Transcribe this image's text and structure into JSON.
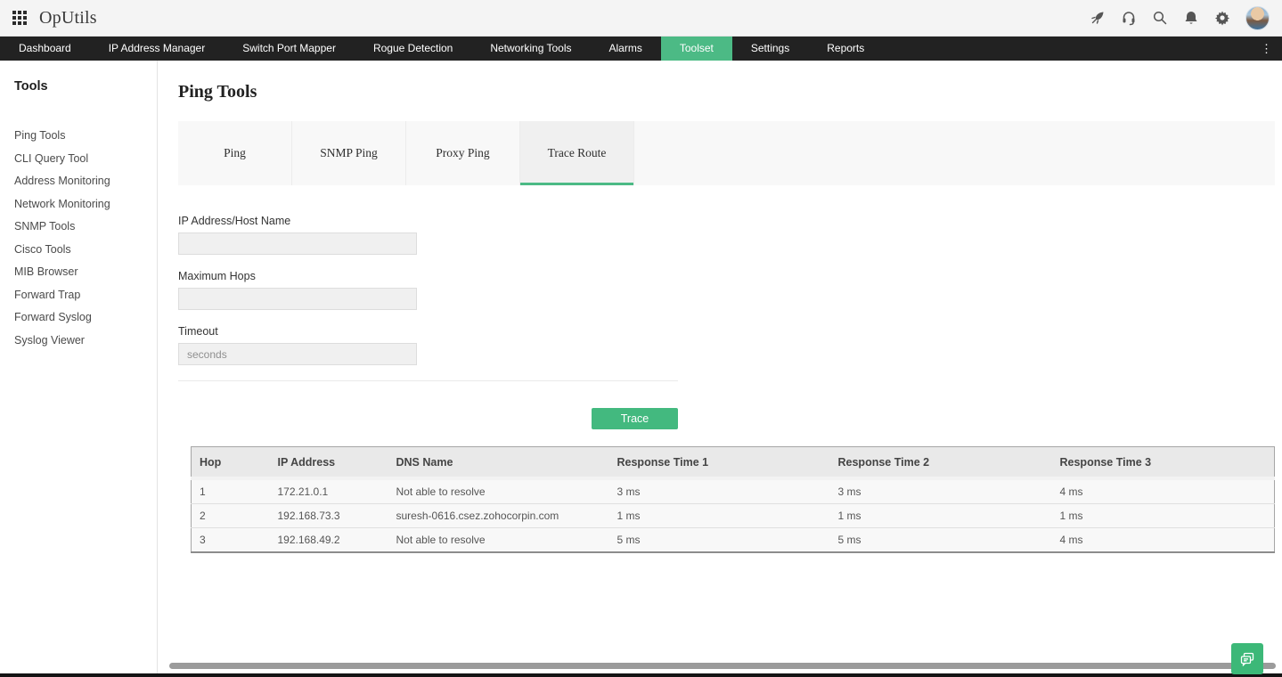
{
  "app": {
    "logo": "OpUtils"
  },
  "topbar": {
    "icons": [
      "launcher-grid-icon",
      "rocket-icon",
      "headset-icon",
      "search-icon",
      "bell-icon",
      "gear-icon",
      "avatar"
    ]
  },
  "topnav": {
    "items": [
      "Dashboard",
      "IP Address Manager",
      "Switch Port Mapper",
      "Rogue Detection",
      "Networking Tools",
      "Alarms",
      "Toolset",
      "Settings",
      "Reports"
    ],
    "active": "Toolset",
    "overflow_glyph": "⋮"
  },
  "sidebar": {
    "heading": "Tools",
    "items": [
      "Ping Tools",
      "CLI Query Tool",
      "Address Monitoring",
      "Network Monitoring",
      "SNMP Tools",
      "Cisco Tools",
      "MIB Browser",
      "Forward Trap",
      "Forward Syslog",
      "Syslog Viewer"
    ]
  },
  "main": {
    "title": "Ping Tools",
    "tabs": [
      "Ping",
      "SNMP Ping",
      "Proxy Ping",
      "Trace Route"
    ],
    "active_tab": "Trace Route",
    "form": {
      "fields": [
        {
          "label": "IP Address/Host Name",
          "value": "",
          "placeholder": ""
        },
        {
          "label": "Maximum Hops",
          "value": "",
          "placeholder": ""
        },
        {
          "label": "Timeout",
          "value": "",
          "placeholder": "seconds"
        }
      ],
      "submit_label": "Trace"
    },
    "table": {
      "columns": [
        "Hop",
        "IP Address",
        "DNS Name",
        "Response Time 1",
        "Response Time 2",
        "Response Time 3"
      ],
      "rows": [
        [
          "1",
          "172.21.0.1",
          "Not able to resolve",
          "3 ms",
          "3 ms",
          "4 ms"
        ],
        [
          "2",
          "192.168.73.3",
          "suresh-0616.csez.zohocorpin.com",
          "1 ms",
          "1 ms",
          "1 ms"
        ],
        [
          "3",
          "192.168.49.2",
          "Not able to resolve",
          "5 ms",
          "5 ms",
          "4 ms"
        ]
      ]
    }
  },
  "colors": {
    "accent_green": "#4cba85",
    "button_green": "#43b97f",
    "navbar_bg": "#222222"
  }
}
